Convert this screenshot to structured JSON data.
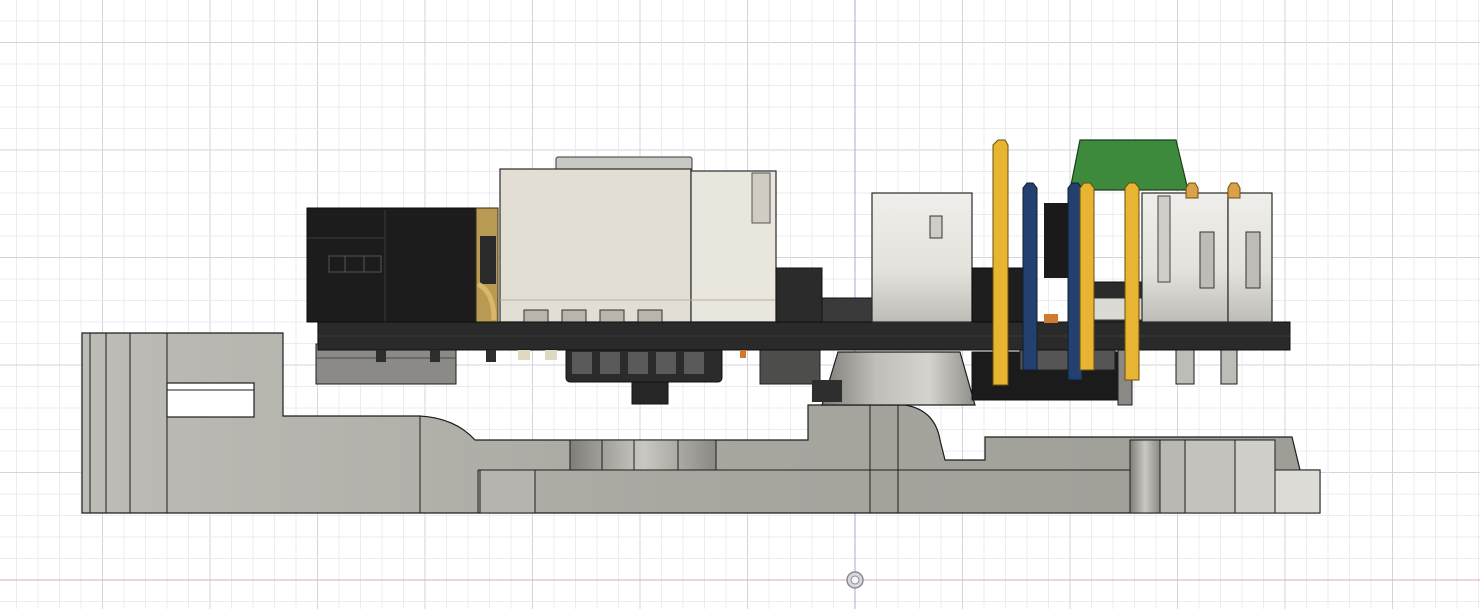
{
  "viewport": {
    "view": "side-orthographic",
    "background": "#ffffff",
    "grid_minor_color": "#ececf0",
    "grid_major_color": "#d4d4dc",
    "axis_vertical_color": "#a9a9d8",
    "axis_horizontal_color": "#e7a9a9"
  },
  "model": {
    "parts": [
      "base-bracket",
      "circuit-board",
      "black-jack-housing",
      "usb-ethernet-connector",
      "connector-housings",
      "header-pins",
      "green-cap",
      "support-post",
      "under-board-components"
    ],
    "colors": {
      "bracket": "#a8a79f",
      "bracket_dark": "#8d8c86",
      "bracket_light": "#c6c5bf",
      "board": "#2a2a2a",
      "black_housing": "#1d1d1d",
      "connector_beige": "#e2ded3",
      "connector_white": "#eae8e2",
      "pin_gold": "#e7b532",
      "pin_blue": "#22416f",
      "green": "#3e8a3c",
      "copper": "#cf7a2e"
    }
  },
  "origin_icon": "origin-marker-icon"
}
